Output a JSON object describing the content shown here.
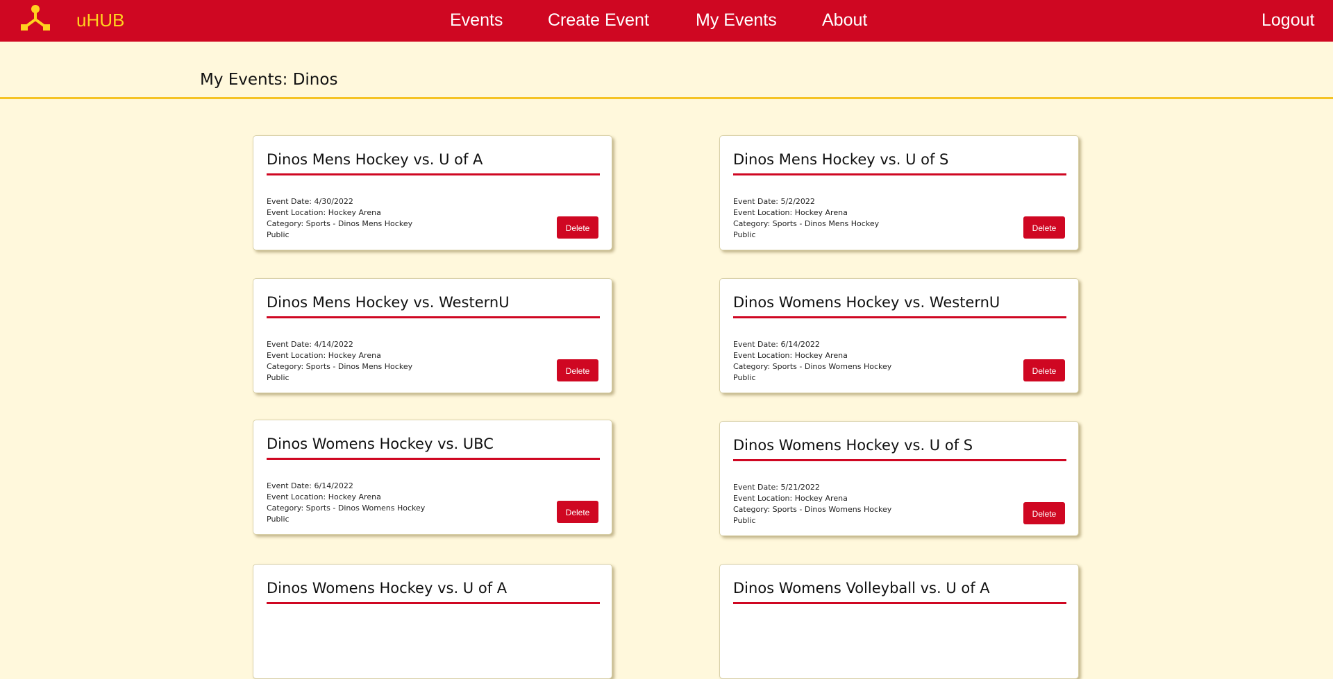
{
  "nav": {
    "brand": "uHUB",
    "links": [
      "Events",
      "Create Event",
      "My Events",
      "About"
    ],
    "logout": "Logout"
  },
  "page": {
    "title": "My Events: Dinos"
  },
  "delete_label": "Delete",
  "events": [
    {
      "title": "Dinos Mens Hockey vs. U of A",
      "date": "Event Date: 4/30/2022",
      "location": "Event Location: Hockey Arena",
      "category": "Category: Sports - Dinos Mens Hockey",
      "visibility": "Public"
    },
    {
      "title": "Dinos Mens Hockey vs. U of S",
      "date": "Event Date: 5/2/2022",
      "location": "Event Location: Hockey Arena",
      "category": "Category: Sports - Dinos Mens Hockey",
      "visibility": "Public"
    },
    {
      "title": "Dinos Mens Hockey vs. WesternU",
      "date": "Event Date: 4/14/2022",
      "location": "Event Location: Hockey Arena",
      "category": "Category: Sports - Dinos Mens Hockey",
      "visibility": "Public"
    },
    {
      "title": "Dinos Womens Hockey vs. WesternU",
      "date": "Event Date: 6/14/2022",
      "location": "Event Location: Hockey Arena",
      "category": "Category: Sports - Dinos Womens Hockey",
      "visibility": "Public"
    },
    {
      "title": "Dinos Womens Hockey vs. UBC",
      "date": "Event Date: 6/14/2022",
      "location": "Event Location: Hockey Arena",
      "category": "Category: Sports - Dinos Womens Hockey",
      "visibility": "Public"
    },
    {
      "title": "Dinos Womens Hockey vs. U of S",
      "date": "Event Date: 5/21/2022",
      "location": "Event Location: Hockey Arena",
      "category": "Category: Sports - Dinos Womens Hockey",
      "visibility": "Public"
    },
    {
      "title": "Dinos Womens Hockey vs. U of A"
    },
    {
      "title": "Dinos Womens Volleyball vs. U of A"
    }
  ],
  "colors": {
    "nav_bg": "#cf0722",
    "brand": "#ffd21f",
    "page_bg": "#fff8dc",
    "accent_rule": "#f5c324"
  },
  "icons": {
    "logo": "network-node-icon"
  }
}
